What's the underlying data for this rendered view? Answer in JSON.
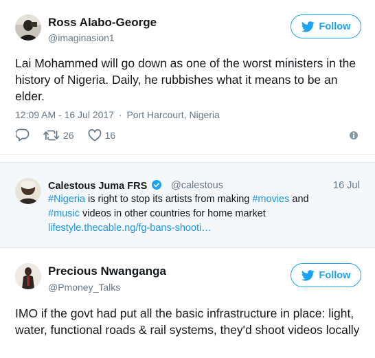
{
  "tweet1": {
    "name": "Ross Alabo-George",
    "handle": "@imaginasion1",
    "follow_label": "Follow",
    "text": "Lai Mohammed will go down as one of the worst ministers in the history of Nigeria. Daily, he rubbishes what it means to be an elder.",
    "timestamp": "12:09 AM - 16 Jul 2017",
    "separator": "·",
    "location": "Port Harcourt, Nigeria",
    "retweets": "26",
    "likes": "16"
  },
  "quote": {
    "name": "Calestous Juma FRS",
    "handle": "@calestous",
    "date": "16 Jul",
    "line1": {
      "hashtag1": "#Nigeria",
      "text1": " is right to stop its artists from making ",
      "hashtag2": "#movies",
      "text2": " and"
    },
    "line2": {
      "hashtag3": "#music",
      "text3": " videos in other countries for home market"
    },
    "link": "lifestyle.thecable.ng/fg-bans-shooti…"
  },
  "tweet2": {
    "name": "Precious Nwanganga",
    "handle": "@Pmoney_Talks",
    "follow_label": "Follow",
    "text": "IMO if the govt had put all the basic infrastructure in place: light, water, functional roads & rail systems, they'd shoot videos locally"
  },
  "colors": {
    "accent": "#1da1f2",
    "link": "#1b95e0",
    "muted": "#657786",
    "text": "#14171a",
    "quote_bg": "#f5f8fa",
    "verified": "#1da1f2"
  }
}
